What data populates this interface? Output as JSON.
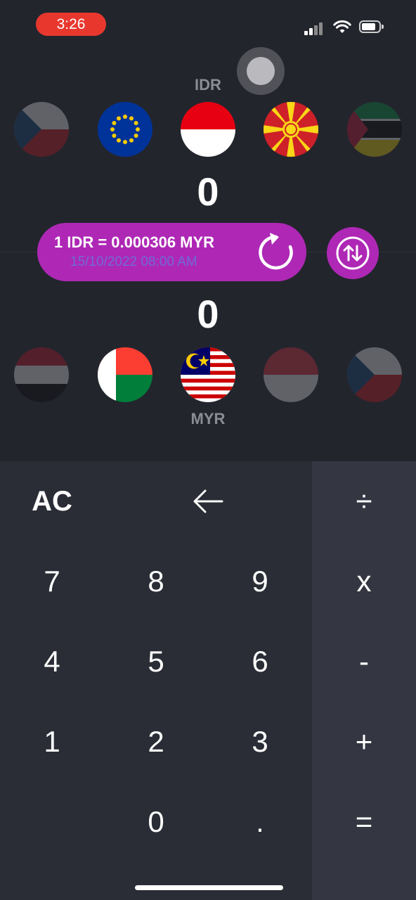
{
  "status_bar": {
    "time": "3:26"
  },
  "converter": {
    "from": {
      "code": "IDR",
      "amount": "0"
    },
    "to": {
      "code": "MYR",
      "amount": "0"
    },
    "rate": {
      "text": "1 IDR = 0.000306 MYR",
      "updated": "15/10/2022 08:00 AM"
    },
    "colors": {
      "accent": "#ae28b5",
      "background": "#23252d"
    },
    "top_flags": [
      "czech-flag",
      "eu-flag",
      "indonesia-flag",
      "north-macedonia-flag",
      "mozambique-flag"
    ],
    "bottom_flags": [
      "yemen-flag",
      "madagascar-flag",
      "malaysia-flag",
      "singapore-flag",
      "czech-flag"
    ]
  },
  "keypad": {
    "rows": [
      [
        "AC",
        "backspace-icon",
        "÷"
      ],
      [
        "7",
        "8",
        "9",
        "x"
      ],
      [
        "4",
        "5",
        "6",
        "-"
      ],
      [
        "1",
        "2",
        "3",
        "+"
      ],
      [
        "",
        "0",
        ".",
        "="
      ]
    ],
    "labels": {
      "ac": "AC",
      "divide": "÷",
      "k7": "7",
      "k8": "8",
      "k9": "9",
      "multiply": "x",
      "k4": "4",
      "k5": "5",
      "k6": "6",
      "minus": "-",
      "k1": "1",
      "k2": "2",
      "k3": "3",
      "plus": "+",
      "k0": "0",
      "dot": ".",
      "equals": "="
    }
  }
}
